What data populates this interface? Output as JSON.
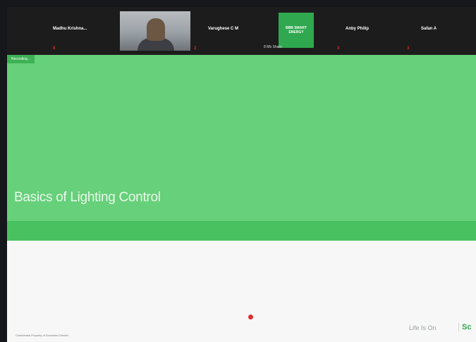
{
  "participants": [
    {
      "name": "Madhu Krishna...",
      "mic": "8"
    },
    {
      "name": "",
      "mic": "2"
    },
    {
      "name": "Varughese C M",
      "mic": ""
    },
    {
      "name": "",
      "mic": ""
    },
    {
      "name": "Anby Philip",
      "mic": "3"
    },
    {
      "name": "Safan A",
      "mic": "3"
    }
  ],
  "logo_tile_text": "BBB SMART ENERGY",
  "logo_tile_subtext": "8 Mb Share",
  "recording_label": "Recording...",
  "slide": {
    "title": "Basics of Lighting Control",
    "footnote": "Confidential Property of Schneider Electric",
    "tagline": "Life Is On",
    "brand": "Sc"
  },
  "colors": {
    "slide_green": "#67d07a",
    "band_green": "#49c160",
    "brand_green": "#2fa84f",
    "pointer_red": "#e02d2d"
  }
}
